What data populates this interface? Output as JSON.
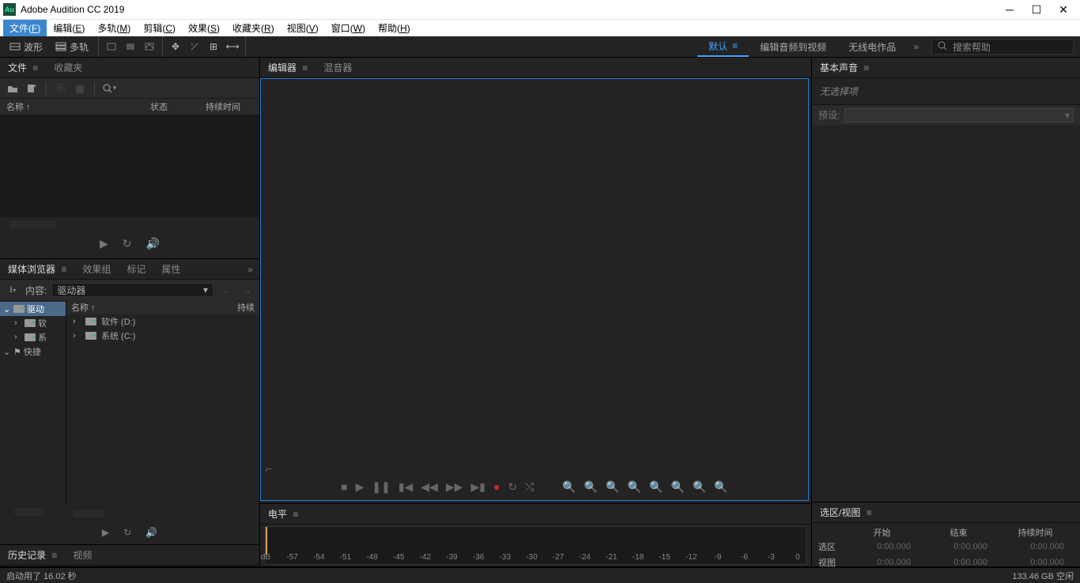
{
  "app": {
    "title": "Adobe Audition CC 2019",
    "icon_text": "Au"
  },
  "menu": [
    {
      "label": "文件",
      "accel": "F",
      "active": true
    },
    {
      "label": "编辑",
      "accel": "E"
    },
    {
      "label": "多轨",
      "accel": "M"
    },
    {
      "label": "剪辑",
      "accel": "C"
    },
    {
      "label": "效果",
      "accel": "S"
    },
    {
      "label": "收藏夹",
      "accel": "R"
    },
    {
      "label": "视图",
      "accel": "V"
    },
    {
      "label": "窗口",
      "accel": "W"
    },
    {
      "label": "帮助",
      "accel": "H"
    }
  ],
  "toolbar": {
    "waveform": "波形",
    "multitrack": "多轨",
    "workspace_tabs": [
      {
        "label": "默认",
        "active": true
      },
      {
        "label": "编辑音频到视频"
      },
      {
        "label": "无线电作品"
      }
    ],
    "search_placeholder": "搜索帮助"
  },
  "files_panel": {
    "tabs": [
      {
        "label": "文件",
        "active": true
      },
      {
        "label": "收藏夹"
      }
    ],
    "columns": {
      "name": "名称 ↑",
      "status": "状态",
      "duration": "持续时间"
    }
  },
  "media_browser": {
    "tabs": [
      {
        "label": "媒体浏览器",
        "active": true
      },
      {
        "label": "效果组"
      },
      {
        "label": "标记"
      },
      {
        "label": "属性"
      }
    ],
    "content_label": "内容:",
    "dropdown": "驱动器",
    "tree": [
      {
        "label": "驱动",
        "expanded": true,
        "selected": true,
        "icon": "drive",
        "indent": 0
      },
      {
        "label": "软",
        "expandable": true,
        "icon": "drive",
        "indent": 1
      },
      {
        "label": "系",
        "expandable": true,
        "icon": "drive",
        "indent": 1
      },
      {
        "label": "快捷",
        "expanded": true,
        "icon": "flag",
        "indent": 0
      }
    ],
    "list_header": {
      "name": "名称 ↑",
      "duration": "持续"
    },
    "list_items": [
      {
        "label": "软件 (D:)",
        "icon": "drive"
      },
      {
        "label": "系统 (C:)",
        "icon": "drive"
      }
    ]
  },
  "history_panel": {
    "tabs": [
      {
        "label": "历史记录",
        "active": true
      },
      {
        "label": "视频"
      }
    ]
  },
  "editor": {
    "tabs": [
      {
        "label": "编辑器",
        "active": true
      },
      {
        "label": "混音器"
      }
    ]
  },
  "level_panel": {
    "tab": "电平",
    "db_label": "dB",
    "marks": [
      -57,
      -54,
      -51,
      -48,
      -45,
      -42,
      -39,
      -36,
      -33,
      -30,
      -27,
      -24,
      -21,
      -18,
      -15,
      -12,
      -9,
      -6,
      -3,
      0
    ]
  },
  "essential_sound": {
    "tab": "基本声音",
    "no_selection": "无选择项",
    "preset_label": "预设:"
  },
  "selection_view": {
    "tab": "选区/视图",
    "headers": {
      "start": "开始",
      "end": "结束",
      "duration": "持续时间"
    },
    "rows": [
      {
        "label": "选区",
        "start": "0:00.000",
        "end": "0:00.000",
        "duration": "0:00.000"
      },
      {
        "label": "视图",
        "start": "0:00.000",
        "end": "0:00.000",
        "duration": "0:00.000"
      }
    ]
  },
  "statusbar": {
    "left": "启动用了 16.02 秒",
    "right": "133.46 GB 空闲"
  }
}
